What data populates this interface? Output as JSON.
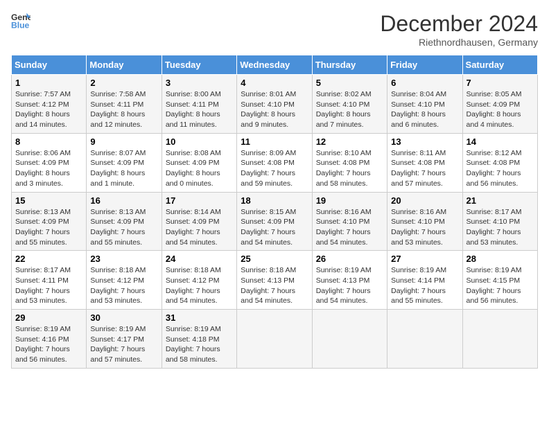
{
  "header": {
    "logo_line1": "General",
    "logo_line2": "Blue",
    "month_title": "December 2024",
    "location": "Riethnordhausen, Germany"
  },
  "weekdays": [
    "Sunday",
    "Monday",
    "Tuesday",
    "Wednesday",
    "Thursday",
    "Friday",
    "Saturday"
  ],
  "weeks": [
    [
      {
        "day": "1",
        "sunrise": "7:57 AM",
        "sunset": "4:12 PM",
        "daylight": "8 hours and 14 minutes."
      },
      {
        "day": "2",
        "sunrise": "7:58 AM",
        "sunset": "4:11 PM",
        "daylight": "8 hours and 12 minutes."
      },
      {
        "day": "3",
        "sunrise": "8:00 AM",
        "sunset": "4:11 PM",
        "daylight": "8 hours and 11 minutes."
      },
      {
        "day": "4",
        "sunrise": "8:01 AM",
        "sunset": "4:10 PM",
        "daylight": "8 hours and 9 minutes."
      },
      {
        "day": "5",
        "sunrise": "8:02 AM",
        "sunset": "4:10 PM",
        "daylight": "8 hours and 7 minutes."
      },
      {
        "day": "6",
        "sunrise": "8:04 AM",
        "sunset": "4:10 PM",
        "daylight": "8 hours and 6 minutes."
      },
      {
        "day": "7",
        "sunrise": "8:05 AM",
        "sunset": "4:09 PM",
        "daylight": "8 hours and 4 minutes."
      }
    ],
    [
      {
        "day": "8",
        "sunrise": "8:06 AM",
        "sunset": "4:09 PM",
        "daylight": "8 hours and 3 minutes."
      },
      {
        "day": "9",
        "sunrise": "8:07 AM",
        "sunset": "4:09 PM",
        "daylight": "8 hours and 1 minute."
      },
      {
        "day": "10",
        "sunrise": "8:08 AM",
        "sunset": "4:09 PM",
        "daylight": "8 hours and 0 minutes."
      },
      {
        "day": "11",
        "sunrise": "8:09 AM",
        "sunset": "4:08 PM",
        "daylight": "7 hours and 59 minutes."
      },
      {
        "day": "12",
        "sunrise": "8:10 AM",
        "sunset": "4:08 PM",
        "daylight": "7 hours and 58 minutes."
      },
      {
        "day": "13",
        "sunrise": "8:11 AM",
        "sunset": "4:08 PM",
        "daylight": "7 hours and 57 minutes."
      },
      {
        "day": "14",
        "sunrise": "8:12 AM",
        "sunset": "4:08 PM",
        "daylight": "7 hours and 56 minutes."
      }
    ],
    [
      {
        "day": "15",
        "sunrise": "8:13 AM",
        "sunset": "4:09 PM",
        "daylight": "7 hours and 55 minutes."
      },
      {
        "day": "16",
        "sunrise": "8:13 AM",
        "sunset": "4:09 PM",
        "daylight": "7 hours and 55 minutes."
      },
      {
        "day": "17",
        "sunrise": "8:14 AM",
        "sunset": "4:09 PM",
        "daylight": "7 hours and 54 minutes."
      },
      {
        "day": "18",
        "sunrise": "8:15 AM",
        "sunset": "4:09 PM",
        "daylight": "7 hours and 54 minutes."
      },
      {
        "day": "19",
        "sunrise": "8:16 AM",
        "sunset": "4:10 PM",
        "daylight": "7 hours and 54 minutes."
      },
      {
        "day": "20",
        "sunrise": "8:16 AM",
        "sunset": "4:10 PM",
        "daylight": "7 hours and 53 minutes."
      },
      {
        "day": "21",
        "sunrise": "8:17 AM",
        "sunset": "4:10 PM",
        "daylight": "7 hours and 53 minutes."
      }
    ],
    [
      {
        "day": "22",
        "sunrise": "8:17 AM",
        "sunset": "4:11 PM",
        "daylight": "7 hours and 53 minutes."
      },
      {
        "day": "23",
        "sunrise": "8:18 AM",
        "sunset": "4:12 PM",
        "daylight": "7 hours and 53 minutes."
      },
      {
        "day": "24",
        "sunrise": "8:18 AM",
        "sunset": "4:12 PM",
        "daylight": "7 hours and 54 minutes."
      },
      {
        "day": "25",
        "sunrise": "8:18 AM",
        "sunset": "4:13 PM",
        "daylight": "7 hours and 54 minutes."
      },
      {
        "day": "26",
        "sunrise": "8:19 AM",
        "sunset": "4:13 PM",
        "daylight": "7 hours and 54 minutes."
      },
      {
        "day": "27",
        "sunrise": "8:19 AM",
        "sunset": "4:14 PM",
        "daylight": "7 hours and 55 minutes."
      },
      {
        "day": "28",
        "sunrise": "8:19 AM",
        "sunset": "4:15 PM",
        "daylight": "7 hours and 56 minutes."
      }
    ],
    [
      {
        "day": "29",
        "sunrise": "8:19 AM",
        "sunset": "4:16 PM",
        "daylight": "7 hours and 56 minutes."
      },
      {
        "day": "30",
        "sunrise": "8:19 AM",
        "sunset": "4:17 PM",
        "daylight": "7 hours and 57 minutes."
      },
      {
        "day": "31",
        "sunrise": "8:19 AM",
        "sunset": "4:18 PM",
        "daylight": "7 hours and 58 minutes."
      },
      null,
      null,
      null,
      null
    ]
  ]
}
